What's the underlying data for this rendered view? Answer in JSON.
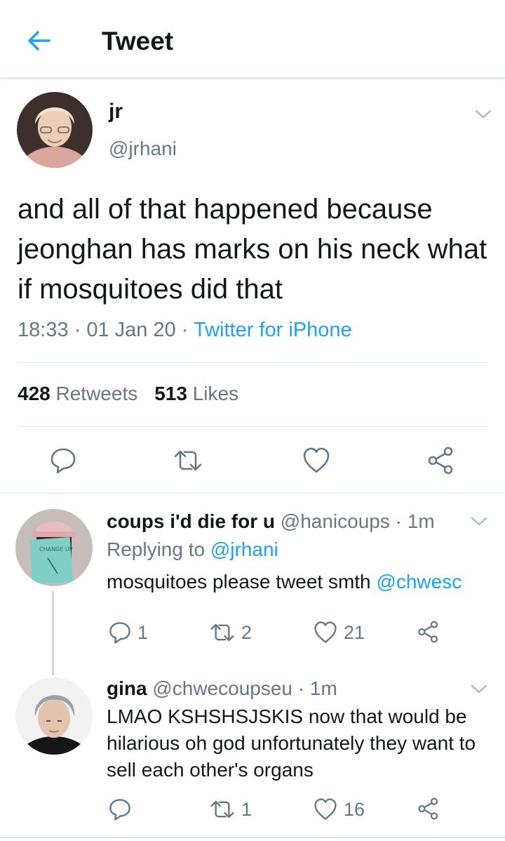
{
  "header": {
    "title": "Tweet"
  },
  "tweet": {
    "name": "jr",
    "handle": "@jrhani",
    "text": "and all of that happened because jeonghan has marks on his neck what if mosquitoes did that",
    "time": "18:33",
    "date": "01 Jan 20",
    "source": "Twitter for iPhone",
    "retweets_count": "428",
    "retweets_label": "Retweets",
    "likes_count": "513",
    "likes_label": "Likes"
  },
  "replies": [
    {
      "name": "coups i'd die for u",
      "handle": "@hanicoups",
      "time": "1m",
      "replying_prefix": "Replying to",
      "replying_to": "@jrhani",
      "text": "mosquitoes please tweet smth",
      "mention": "@chwesc",
      "avatar_text": "CHANGE UP",
      "reply_count": "1",
      "retweet_count": "2",
      "like_count": "21"
    },
    {
      "name": "gina",
      "handle": "@chwecoupseu",
      "time": "1m",
      "text": "LMAO KSHSHSJSKIS now that would be hilarious oh god unfortunately they want to sell each other's organs",
      "reply_count": "",
      "retweet_count": "1",
      "like_count": "16"
    }
  ],
  "icons": {
    "back": "arrow-left-icon",
    "chevron": "chevron-down-icon",
    "reply": "reply-icon",
    "retweet": "retweet-icon",
    "like": "heart-icon",
    "share": "share-icon"
  },
  "colors": {
    "accent": "#1da1f2",
    "secondary_text": "#657786",
    "primary_text": "#14171a",
    "divider": "#e1e8ed"
  }
}
